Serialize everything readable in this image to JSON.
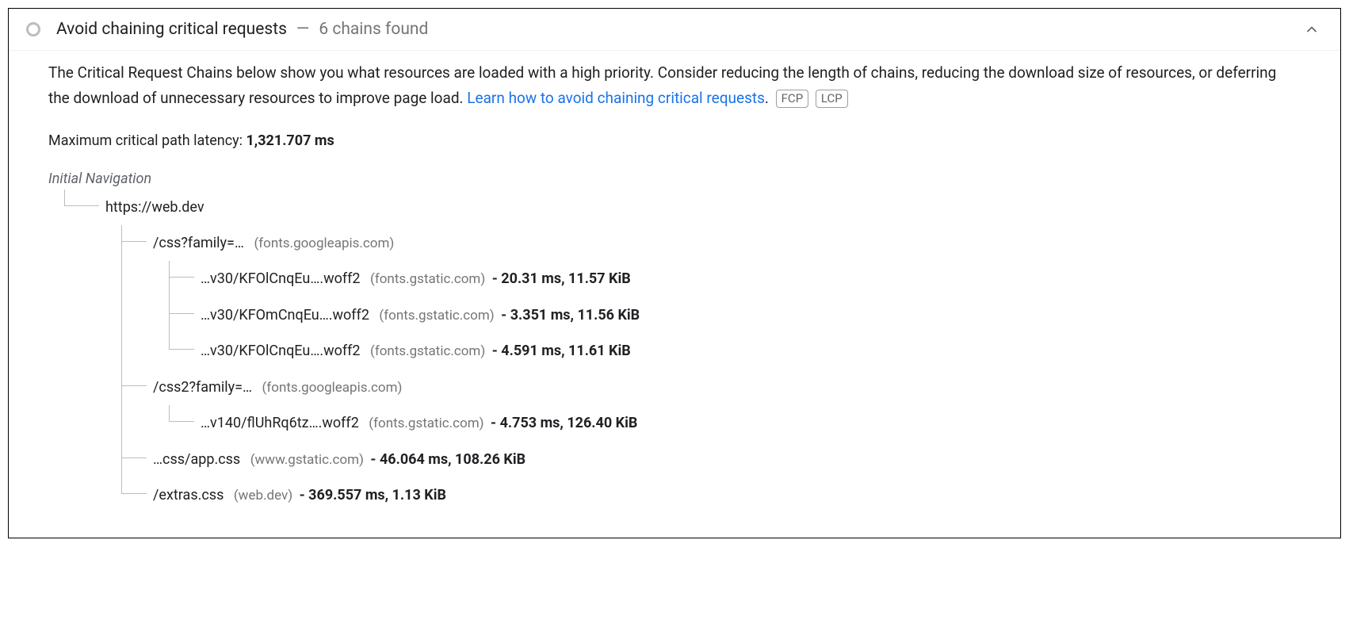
{
  "header": {
    "title": "Avoid chaining critical requests",
    "count_text": "6 chains found"
  },
  "description": {
    "text_pre": "The Critical Request Chains below show you what resources are loaded with a high priority. Consider reducing the length of chains, reducing the download size of resources, or deferring the download of unnecessary resources to improve page load. ",
    "link_text": "Learn how to avoid chaining critical requests",
    "period": ".",
    "badge1": "FCP",
    "badge2": "LCP"
  },
  "latency": {
    "label": "Maximum critical path latency: ",
    "value": "1,321.707 ms"
  },
  "tree": {
    "initial_label": "Initial Navigation",
    "root": {
      "url": "https://web.dev"
    },
    "children": [
      {
        "url": "/css?family=…",
        "host": "(fonts.googleapis.com)",
        "children": [
          {
            "url": "…v30/KFOlCnqEu….woff2",
            "host": "(fonts.gstatic.com)",
            "stats": "- 20.31 ms, 11.57 KiB"
          },
          {
            "url": "…v30/KFOmCnqEu….woff2",
            "host": "(fonts.gstatic.com)",
            "stats": "- 3.351 ms, 11.56 KiB"
          },
          {
            "url": "…v30/KFOlCnqEu….woff2",
            "host": "(fonts.gstatic.com)",
            "stats": "- 4.591 ms, 11.61 KiB"
          }
        ]
      },
      {
        "url": "/css2?family=…",
        "host": "(fonts.googleapis.com)",
        "children": [
          {
            "url": "…v140/flUhRq6tz….woff2",
            "host": "(fonts.gstatic.com)",
            "stats": "- 4.753 ms, 126.40 KiB"
          }
        ]
      },
      {
        "url": "…css/app.css",
        "host": "(www.gstatic.com)",
        "stats": "- 46.064 ms, 108.26 KiB"
      },
      {
        "url": "/extras.css",
        "host": "(web.dev)",
        "stats": "- 369.557 ms, 1.13 KiB"
      }
    ]
  }
}
